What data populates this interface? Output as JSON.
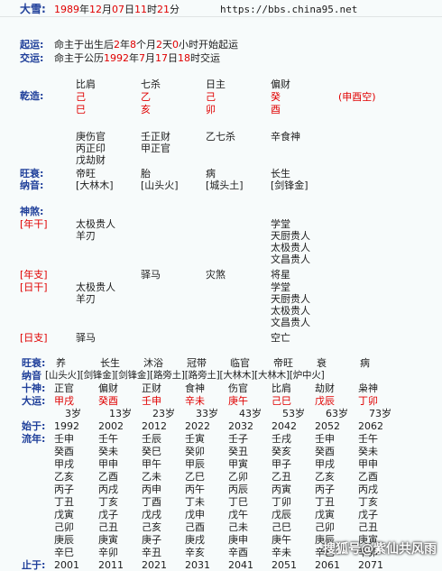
{
  "header": {
    "label": "大雪:",
    "date_red": "1989",
    "y": "年",
    "m_red": "12",
    "m": "月",
    "d_red": "07",
    "dd": "日",
    "h_red": "11",
    "hh": "时",
    "mi_red": "21",
    "mm": "分",
    "url": "https://bbs.china95.net"
  },
  "qiyun": {
    "label": "起运:",
    "text": [
      "命主于出生后",
      "2",
      "年",
      "8",
      "个月",
      "2",
      "天",
      "0",
      "小时开始起运"
    ]
  },
  "jiaoyun": {
    "label": "交运:",
    "text": [
      "命主于公历",
      "1992",
      "年",
      "7",
      "月",
      "17",
      "日",
      "18",
      "时交运"
    ]
  },
  "qianzao_label": "乾造:",
  "shishen": [
    "比肩",
    "七杀",
    "日主",
    "偏财"
  ],
  "tiangan": [
    "己",
    "乙",
    "己",
    "癸"
  ],
  "dizhi": [
    "巳",
    "亥",
    "卯",
    "酉"
  ],
  "kong": "(申酉空)",
  "canggan": [
    [
      "庚伤官",
      "丙正印",
      "戊劫财"
    ],
    [
      "壬正财",
      "甲正官"
    ],
    [
      "乙七杀"
    ],
    [
      "辛食神"
    ]
  ],
  "wangshuai_label": "旺衰:",
  "wangshuai": [
    "帝旺",
    "胎",
    "病",
    "长生"
  ],
  "nayin_label": "纳音:",
  "nayin": [
    "[大林木]",
    "[山头火]",
    "[城头土]",
    "[剑锋金]"
  ],
  "shensha_label": "神煞:",
  "nian_gan_label": "[年干]",
  "ng_col1": [
    "太极贵人",
    "羊刃"
  ],
  "ng_col4": [
    "学堂",
    "天厨贵人",
    "太极贵人",
    "文昌贵人"
  ],
  "nian_zhi_label": "[年支]",
  "ri_gan_label": "[日干]",
  "nz_col2": "驿马",
  "nz_col3": "灾煞",
  "nz_col4": "将星",
  "rg_col1": [
    "太极贵人",
    "羊刃"
  ],
  "rg_col4": [
    "学堂",
    "天厨贵人",
    "太极贵人",
    "文昌贵人"
  ],
  "ri_zhi_label": "[日支]",
  "rz_col1": "驿马",
  "rz_col4": "空亡",
  "dy_wangshuai_label": "旺衰:",
  "dy_wangshuai": [
    "养",
    "长生",
    "沐浴",
    "冠带",
    "临官",
    "帝旺",
    "衰",
    "病"
  ],
  "dy_nayin_label": "纳音",
  "dy_nayin": "[山头火][剑锋金][剑锋金][路旁土][路旁土][大林木][大林木][炉中火]",
  "dy_shishen_label": "十神:",
  "dy_shishen": [
    "正官",
    "偏财",
    "正财",
    "食神",
    "伤官",
    "比肩",
    "劫财",
    "枭神"
  ],
  "dayun_label": "大运:",
  "dayun": [
    "甲戌",
    "癸酉",
    "壬申",
    "辛未",
    "庚午",
    "己巳",
    "戊辰",
    "丁卯"
  ],
  "sui": [
    "3岁",
    "13岁",
    "23岁",
    "33岁",
    "43岁",
    "53岁",
    "63岁",
    "73岁"
  ],
  "shiyu_label": "始于:",
  "shiyu": [
    "1992",
    "2002",
    "2012",
    "2022",
    "2032",
    "2042",
    "2052",
    "2062"
  ],
  "liunian_label": "流年:",
  "liunian": [
    [
      "壬申",
      "壬午",
      "壬辰",
      "壬寅",
      "壬子",
      "壬戌",
      "壬申",
      "壬午"
    ],
    [
      "癸酉",
      "癸未",
      "癸巳",
      "癸卯",
      "癸丑",
      "癸亥",
      "癸酉",
      "癸未"
    ],
    [
      "甲戌",
      "甲申",
      "甲午",
      "甲辰",
      "甲寅",
      "甲子",
      "甲戌",
      "甲申"
    ],
    [
      "乙亥",
      "乙酉",
      "乙未",
      "乙巳",
      "乙卯",
      "乙丑",
      "乙亥",
      "乙酉"
    ],
    [
      "丙子",
      "丙戌",
      "丙申",
      "丙午",
      "丙辰",
      "丙寅",
      "丙子",
      "丙戌"
    ],
    [
      "丁丑",
      "丁亥",
      "丁酉",
      "丁未",
      "丁巳",
      "丁卯",
      "丁丑",
      "丁亥"
    ],
    [
      "戊寅",
      "戊子",
      "戊戌",
      "戊申",
      "戊午",
      "戊辰",
      "戊寅",
      "戊子"
    ],
    [
      "己卯",
      "己丑",
      "己亥",
      "己酉",
      "己未",
      "己巳",
      "己卯",
      "己丑"
    ],
    [
      "庚辰",
      "庚寅",
      "庚子",
      "庚戌",
      "庚申",
      "庚午",
      "庚辰",
      "庚寅"
    ],
    [
      "辛巳",
      "辛卯",
      "辛丑",
      "辛亥",
      "辛酉",
      "辛未",
      "辛巳",
      "辛卯"
    ]
  ],
  "zhiyu_label": "止于:",
  "zhiyu": [
    "2001",
    "2011",
    "2021",
    "2031",
    "2041",
    "2051",
    "2061",
    "2071"
  ],
  "watermark": "搜狐号@紫仙共风雨"
}
